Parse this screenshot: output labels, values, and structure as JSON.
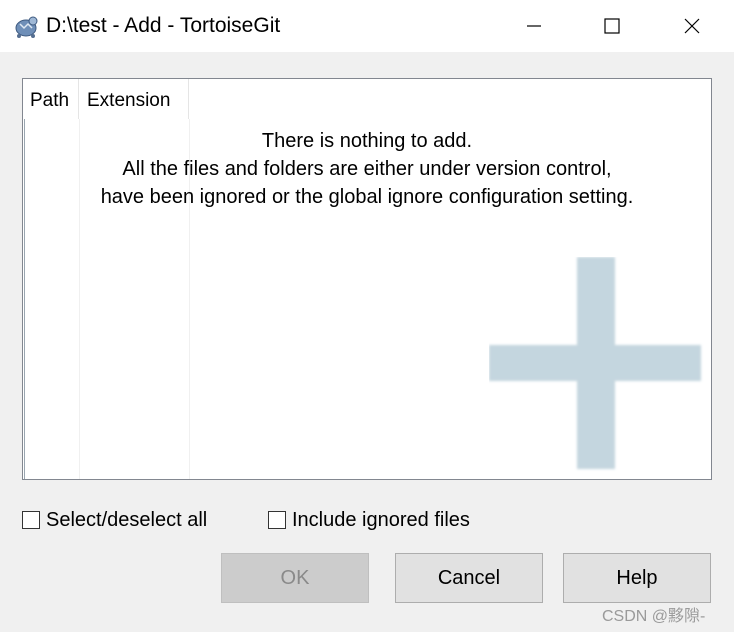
{
  "window": {
    "title": "D:\\test - Add - TortoiseGit",
    "app_icon": "tortoisegit-icon"
  },
  "list": {
    "columns": [
      "Path",
      "Extension"
    ],
    "empty_message": [
      "There is nothing to add.",
      "All the files and folders are either under version control,",
      "have been ignored or the global ignore configuration setting."
    ]
  },
  "options": {
    "select_all_label": "Select/deselect all",
    "include_ignored_label": "Include ignored files",
    "select_all_checked": false,
    "include_ignored_checked": false
  },
  "buttons": {
    "ok": "OK",
    "cancel": "Cancel",
    "help": "Help"
  },
  "watermark": "CSDN @黟隙-",
  "colors": {
    "plus_watermark": "#c4d6df",
    "button_bg": "#e1e1e1",
    "disabled_button_bg": "#cccccc"
  }
}
